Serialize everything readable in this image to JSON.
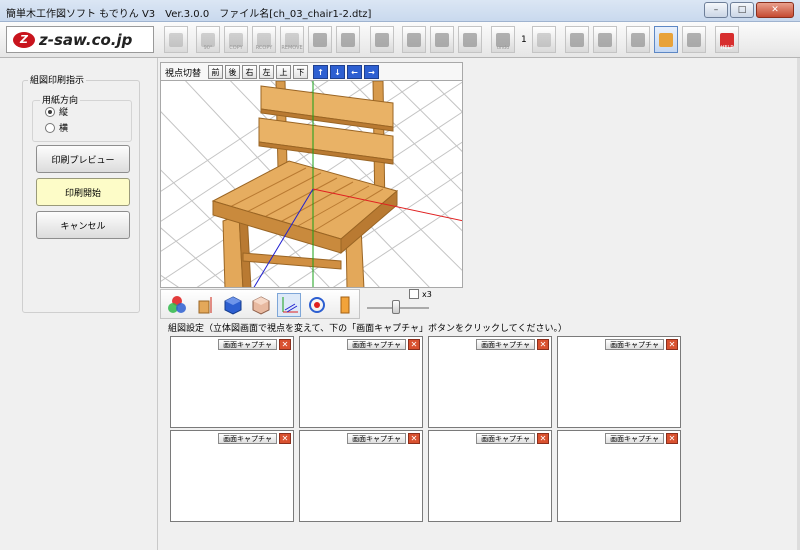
{
  "window": {
    "title": "簡単木工作図ソフト もでりん V3　Ver.3.0.0　ファイル名[ch_03_chair1-2.dtz]",
    "controls": {
      "minimize": "–",
      "maximize": "□",
      "close": "✕"
    }
  },
  "toolbar": {
    "logo_text": "z-saw.co.jp",
    "logo_mark": "Z",
    "labels": {
      "rotate": "90°",
      "copy": "COPY",
      "rcopy": "RCOPY",
      "remove": "REMOVE",
      "undo": "undo",
      "help": "HELP"
    },
    "undo_count": "1"
  },
  "print_panel": {
    "group_title": "組図印刷指示",
    "orientation_title": "用紙方向",
    "orientation_options": [
      {
        "label": "縦",
        "selected": true
      },
      {
        "label": "横",
        "selected": false
      }
    ],
    "preview_button": "印刷プレビュー",
    "start_button": "印刷開始",
    "cancel_button": "キャンセル"
  },
  "viewpoint": {
    "label": "視点切替",
    "buttons": [
      "前",
      "後",
      "右",
      "左",
      "上",
      "下"
    ],
    "arrows": [
      "↑",
      "↓",
      "←",
      "→"
    ]
  },
  "view_options": {
    "x3_label": "x3",
    "x3_checked": false
  },
  "capture": {
    "guide_text": "組図設定（立体図画面で視点を変えて、下の「画面キャプチャ」ボタンをクリックしてください。）",
    "slot_button_label": "画面キャプチャ",
    "slot_delete_label": "✕",
    "slots": 8
  },
  "colors": {
    "wood": "#e3a85a",
    "wood_dark": "#b97a32",
    "floor_grid": "#bdbdbd",
    "axis_x": "#e02020",
    "axis_y": "#18a018",
    "axis_z": "#2020d0",
    "accent_blue": "#2d5fd1"
  }
}
